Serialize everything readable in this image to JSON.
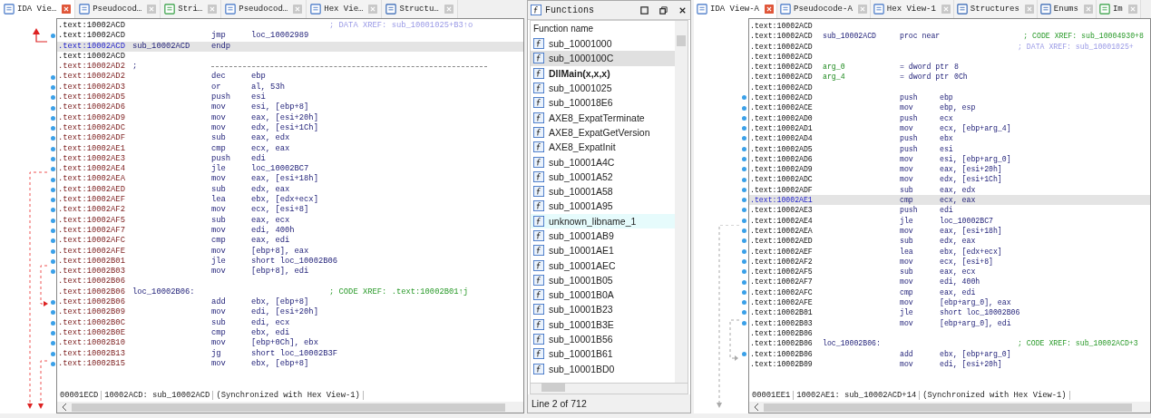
{
  "left_view": {
    "tabs": [
      {
        "label": "IDA Vie…",
        "kind": "listing",
        "selected": true
      },
      {
        "label": "Pseudocod…",
        "kind": "pseudocode",
        "selected": false
      },
      {
        "label": "Stri…",
        "kind": "strings",
        "selected": false
      },
      {
        "label": "Pseudocod…",
        "kind": "pseudocode",
        "selected": false
      },
      {
        "label": "Hex Vie…",
        "kind": "hex",
        "selected": false
      },
      {
        "label": "Structu…",
        "kind": "struct",
        "selected": false
      }
    ],
    "lines": [
      {
        "address": {
          "text": ".text:10002ACD",
          "kind": "plain"
        },
        "comment": {
          "text": "; DATA XREF: sub_10001025+B3↑o",
          "kind": "data"
        },
        "highlighted": false,
        "dot": false
      },
      {
        "address": {
          "text": ".text:10002ACD",
          "kind": "plain"
        },
        "mnemonic": "jmp",
        "operands": "loc_10002989",
        "highlighted": false,
        "dot": true
      },
      {
        "address": {
          "text": ".text:10002ACD"
        },
        "label": {
          "text": "sub_10002ACD",
          "kind": "name"
        },
        "mnemonic": "endp",
        "highlighted": true,
        "dot": false
      },
      {
        "address": {
          "text": ".text:10002ACD",
          "kind": "plain"
        },
        "highlighted": false,
        "dot": false
      },
      {
        "address": {
          "text": ".text:10002AD2",
          "kind": "code"
        },
        "label": {
          "text": ";",
          "kind": "name"
        },
        "separator": true,
        "highlighted": false,
        "dot": false
      },
      {
        "address": {
          "text": ".text:10002AD2",
          "kind": "code"
        },
        "mnemonic": "dec",
        "operands": "ebp",
        "highlighted": false,
        "dot": true
      },
      {
        "address": {
          "text": ".text:10002AD3",
          "kind": "code"
        },
        "mnemonic": "or",
        "operands": "al, 53h",
        "highlighted": false,
        "dot": true
      },
      {
        "address": {
          "text": ".text:10002AD5",
          "kind": "code"
        },
        "mnemonic": "push",
        "operands": "esi",
        "highlighted": false,
        "dot": true
      },
      {
        "address": {
          "text": ".text:10002AD6",
          "kind": "code"
        },
        "mnemonic": "mov",
        "operands": "esi, [ebp+8]",
        "highlighted": false,
        "dot": true
      },
      {
        "address": {
          "text": ".text:10002AD9",
          "kind": "code"
        },
        "mnemonic": "mov",
        "operands": "eax, [esi+20h]",
        "highlighted": false,
        "dot": true
      },
      {
        "address": {
          "text": ".text:10002ADC",
          "kind": "code"
        },
        "mnemonic": "mov",
        "operands": "edx, [esi+1Ch]",
        "highlighted": false,
        "dot": true
      },
      {
        "address": {
          "text": ".text:10002ADF",
          "kind": "code"
        },
        "mnemonic": "sub",
        "operands": "eax, edx",
        "highlighted": false,
        "dot": true
      },
      {
        "address": {
          "text": ".text:10002AE1",
          "kind": "code"
        },
        "mnemonic": "cmp",
        "operands": "ecx, eax",
        "highlighted": false,
        "dot": true
      },
      {
        "address": {
          "text": ".text:10002AE3",
          "kind": "code"
        },
        "mnemonic": "push",
        "operands": "edi",
        "highlighted": false,
        "dot": true
      },
      {
        "address": {
          "text": ".text:10002AE4",
          "kind": "code"
        },
        "mnemonic": "jle",
        "operands": "loc_10002BC7",
        "highlighted": false,
        "dot": true
      },
      {
        "address": {
          "text": ".text:10002AEA",
          "kind": "code"
        },
        "mnemonic": "mov",
        "operands": "eax, [esi+18h]",
        "highlighted": false,
        "dot": true
      },
      {
        "address": {
          "text": ".text:10002AED",
          "kind": "code"
        },
        "mnemonic": "sub",
        "operands": "edx, eax",
        "highlighted": false,
        "dot": true
      },
      {
        "address": {
          "text": ".text:10002AEF",
          "kind": "code"
        },
        "mnemonic": "lea",
        "operands": "ebx, [edx+ecx]",
        "highlighted": false,
        "dot": true
      },
      {
        "address": {
          "text": ".text:10002AF2",
          "kind": "code"
        },
        "mnemonic": "mov",
        "operands": "ecx, [esi+8]",
        "highlighted": false,
        "dot": true
      },
      {
        "address": {
          "text": ".text:10002AF5",
          "kind": "code"
        },
        "mnemonic": "sub",
        "operands": "eax, ecx",
        "highlighted": false,
        "dot": true
      },
      {
        "address": {
          "text": ".text:10002AF7",
          "kind": "code"
        },
        "mnemonic": "mov",
        "operands": "edi, 400h",
        "highlighted": false,
        "dot": true
      },
      {
        "address": {
          "text": ".text:10002AFC",
          "kind": "code"
        },
        "mnemonic": "cmp",
        "operands": "eax, edi",
        "highlighted": false,
        "dot": true
      },
      {
        "address": {
          "text": ".text:10002AFE",
          "kind": "code"
        },
        "mnemonic": "mov",
        "operands": "[ebp+8], eax",
        "highlighted": false,
        "dot": true
      },
      {
        "address": {
          "text": ".text:10002B01",
          "kind": "code"
        },
        "mnemonic": "jle",
        "operands": "short loc_10002B06",
        "highlighted": false,
        "dot": true
      },
      {
        "address": {
          "text": ".text:10002B03",
          "kind": "code"
        },
        "mnemonic": "mov",
        "operands": "[ebp+8], edi",
        "highlighted": false,
        "dot": true
      },
      {
        "address": {
          "text": ".text:10002B06",
          "kind": "code"
        },
        "highlighted": false,
        "dot": false
      },
      {
        "address": {
          "text": ".text:10002B06",
          "kind": "code"
        },
        "label": {
          "text": "loc_10002B06:",
          "kind": "name"
        },
        "comment": {
          "text": "; CODE XREF: .text:10002B01↑j",
          "kind": "code"
        },
        "highlighted": false,
        "dot": false
      },
      {
        "address": {
          "text": ".text:10002B06",
          "kind": "code"
        },
        "mnemonic": "add",
        "operands": "ebx, [ebp+8]",
        "highlighted": false,
        "dot": true
      },
      {
        "address": {
          "text": ".text:10002B09",
          "kind": "code"
        },
        "mnemonic": "mov",
        "operands": "edi, [esi+20h]",
        "highlighted": false,
        "dot": true
      },
      {
        "address": {
          "text": ".text:10002B0C",
          "kind": "code"
        },
        "mnemonic": "sub",
        "operands": "edi, ecx",
        "highlighted": false,
        "dot": true
      },
      {
        "address": {
          "text": ".text:10002B0E",
          "kind": "code"
        },
        "mnemonic": "cmp",
        "operands": "ebx, edi",
        "highlighted": false,
        "dot": true
      },
      {
        "address": {
          "text": ".text:10002B10",
          "kind": "code"
        },
        "mnemonic": "mov",
        "operands": "[ebp+0Ch], ebx",
        "highlighted": false,
        "dot": true
      },
      {
        "address": {
          "text": ".text:10002B13",
          "kind": "code"
        },
        "mnemonic": "jg",
        "operands": "short loc_10002B3F",
        "highlighted": false,
        "dot": true
      },
      {
        "address": {
          "text": ".text:10002B15",
          "kind": "code"
        },
        "mnemonic": "mov",
        "operands": "ebx, [ebp+8]",
        "highlighted": false,
        "dot": true
      }
    ],
    "status_bar": [
      "00001ECD",
      "10002ACD: sub_10002ACD",
      "(Synchronized with Hex View-1)"
    ]
  },
  "functions": {
    "title": "Functions",
    "column": "Function name",
    "items": [
      {
        "name": "sub_10001000",
        "kind": "regular",
        "selected": false
      },
      {
        "name": "sub_1000100C",
        "kind": "regular",
        "selected": true
      },
      {
        "name": "DllMain(x,x,x)",
        "kind": "entry",
        "selected": false
      },
      {
        "name": "sub_10001025",
        "kind": "regular",
        "selected": false
      },
      {
        "name": "sub_100018E6",
        "kind": "regular",
        "selected": false
      },
      {
        "name": "AXE8_ExpatTerminate",
        "kind": "regular",
        "selected": false
      },
      {
        "name": "AXE8_ExpatGetVersion",
        "kind": "regular",
        "selected": false
      },
      {
        "name": "AXE8_ExpatInit",
        "kind": "regular",
        "selected": false
      },
      {
        "name": "sub_10001A4C",
        "kind": "regular",
        "selected": false
      },
      {
        "name": "sub_10001A52",
        "kind": "regular",
        "selected": false
      },
      {
        "name": "sub_10001A58",
        "kind": "regular",
        "selected": false
      },
      {
        "name": "sub_10001A95",
        "kind": "regular",
        "selected": false
      },
      {
        "name": "unknown_libname_1",
        "kind": "library",
        "selected": false
      },
      {
        "name": "sub_10001AB9",
        "kind": "regular",
        "selected": false
      },
      {
        "name": "sub_10001AE1",
        "kind": "regular",
        "selected": false
      },
      {
        "name": "sub_10001AEC",
        "kind": "regular",
        "selected": false
      },
      {
        "name": "sub_10001B05",
        "kind": "regular",
        "selected": false
      },
      {
        "name": "sub_10001B0A",
        "kind": "regular",
        "selected": false
      },
      {
        "name": "sub_10001B23",
        "kind": "regular",
        "selected": false
      },
      {
        "name": "sub_10001B3E",
        "kind": "regular",
        "selected": false
      },
      {
        "name": "sub_10001B56",
        "kind": "regular",
        "selected": false
      },
      {
        "name": "sub_10001B61",
        "kind": "regular",
        "selected": false
      },
      {
        "name": "sub_10001BD0",
        "kind": "regular",
        "selected": false
      }
    ],
    "status": "Line 2 of 712"
  },
  "right_view": {
    "tabs": [
      {
        "label": "IDA View-A",
        "kind": "listing",
        "selected": true
      },
      {
        "label": "Pseudocode-A",
        "kind": "pseudocode",
        "selected": false
      },
      {
        "label": "Hex View-1",
        "kind": "hex",
        "selected": false
      },
      {
        "label": "Structures",
        "kind": "struct",
        "selected": false
      },
      {
        "label": "Enums",
        "kind": "enum",
        "selected": false
      },
      {
        "label": "Im",
        "kind": "imports",
        "selected": false
      }
    ],
    "lines": [
      {
        "address": {
          "text": ".text:10002ACD",
          "kind": "plain"
        },
        "highlighted": false,
        "dot": false
      },
      {
        "address": {
          "text": ".text:10002ACD",
          "kind": "plain"
        },
        "label": {
          "text": "sub_10002ACD",
          "kind": "name"
        },
        "mnemonic": "proc near",
        "comment": {
          "text": "; CODE XREF: sub_10004930+8",
          "kind": "code"
        },
        "highlighted": false,
        "dot": false
      },
      {
        "address": {
          "text": ".text:10002ACD",
          "kind": "plain"
        },
        "comment": {
          "text": "; DATA XREF: sub_10001025+",
          "kind": "data"
        },
        "highlighted": false,
        "dot": false
      },
      {
        "address": {
          "text": ".text:10002ACD",
          "kind": "plain"
        },
        "highlighted": false,
        "dot": false
      },
      {
        "address": {
          "text": ".text:10002ACD",
          "kind": "plain"
        },
        "label": {
          "text": "arg_0",
          "kind": "argument"
        },
        "mnemonic": "= dword ptr",
        "operands": "8",
        "highlighted": false,
        "dot": false
      },
      {
        "address": {
          "text": ".text:10002ACD",
          "kind": "plain"
        },
        "label": {
          "text": "arg_4",
          "kind": "argument"
        },
        "mnemonic": "= dword ptr",
        "operands": "0Ch",
        "highlighted": false,
        "dot": false
      },
      {
        "address": {
          "text": ".text:10002ACD",
          "kind": "plain"
        },
        "highlighted": false,
        "dot": false
      },
      {
        "address": {
          "text": ".text:10002ACD",
          "kind": "plain"
        },
        "mnemonic": "push",
        "operands": "ebp",
        "highlighted": false,
        "dot": true
      },
      {
        "address": {
          "text": ".text:10002ACE",
          "kind": "plain"
        },
        "mnemonic": "mov",
        "operands": "ebp, esp",
        "highlighted": false,
        "dot": true
      },
      {
        "address": {
          "text": ".text:10002AD0",
          "kind": "plain"
        },
        "mnemonic": "push",
        "operands": "ecx",
        "highlighted": false,
        "dot": true
      },
      {
        "address": {
          "text": ".text:10002AD1",
          "kind": "plain"
        },
        "mnemonic": "mov",
        "operands": "ecx, [ebp+arg_4]",
        "highlighted": false,
        "dot": true
      },
      {
        "address": {
          "text": ".text:10002AD4",
          "kind": "plain"
        },
        "mnemonic": "push",
        "operands": "ebx",
        "highlighted": false,
        "dot": true
      },
      {
        "address": {
          "text": ".text:10002AD5",
          "kind": "plain"
        },
        "mnemonic": "push",
        "operands": "esi",
        "highlighted": false,
        "dot": true
      },
      {
        "address": {
          "text": ".text:10002AD6",
          "kind": "plain"
        },
        "mnemonic": "mov",
        "operands": "esi, [ebp+arg_0]",
        "highlighted": false,
        "dot": true
      },
      {
        "address": {
          "text": ".text:10002AD9",
          "kind": "plain"
        },
        "mnemonic": "mov",
        "operands": "eax, [esi+20h]",
        "highlighted": false,
        "dot": true
      },
      {
        "address": {
          "text": ".text:10002ADC",
          "kind": "plain"
        },
        "mnemonic": "mov",
        "operands": "edx, [esi+1Ch]",
        "highlighted": false,
        "dot": true
      },
      {
        "address": {
          "text": ".text:10002ADF",
          "kind": "plain"
        },
        "mnemonic": "sub",
        "operands": "eax, edx",
        "highlighted": false,
        "dot": true
      },
      {
        "address": {
          "text": ".text:10002AE1"
        },
        "mnemonic": "cmp",
        "operands": "ecx, eax",
        "highlighted": true,
        "dot": true
      },
      {
        "address": {
          "text": ".text:10002AE3",
          "kind": "plain"
        },
        "mnemonic": "push",
        "operands": "edi",
        "highlighted": false,
        "dot": true
      },
      {
        "address": {
          "text": ".text:10002AE4",
          "kind": "plain"
        },
        "mnemonic": "jle",
        "operands": "loc_10002BC7",
        "highlighted": false,
        "dot": true
      },
      {
        "address": {
          "text": ".text:10002AEA",
          "kind": "plain"
        },
        "mnemonic": "mov",
        "operands": "eax, [esi+18h]",
        "highlighted": false,
        "dot": true
      },
      {
        "address": {
          "text": ".text:10002AED",
          "kind": "plain"
        },
        "mnemonic": "sub",
        "operands": "edx, eax",
        "highlighted": false,
        "dot": true
      },
      {
        "address": {
          "text": ".text:10002AEF",
          "kind": "plain"
        },
        "mnemonic": "lea",
        "operands": "ebx, [edx+ecx]",
        "highlighted": false,
        "dot": true
      },
      {
        "address": {
          "text": ".text:10002AF2",
          "kind": "plain"
        },
        "mnemonic": "mov",
        "operands": "ecx, [esi+8]",
        "highlighted": false,
        "dot": true
      },
      {
        "address": {
          "text": ".text:10002AF5",
          "kind": "plain"
        },
        "mnemonic": "sub",
        "operands": "eax, ecx",
        "highlighted": false,
        "dot": true
      },
      {
        "address": {
          "text": ".text:10002AF7",
          "kind": "plain"
        },
        "mnemonic": "mov",
        "operands": "edi, 400h",
        "highlighted": false,
        "dot": true
      },
      {
        "address": {
          "text": ".text:10002AFC",
          "kind": "plain"
        },
        "mnemonic": "cmp",
        "operands": "eax, edi",
        "highlighted": false,
        "dot": true
      },
      {
        "address": {
          "text": ".text:10002AFE",
          "kind": "plain"
        },
        "mnemonic": "mov",
        "operands": "[ebp+arg_0], eax",
        "highlighted": false,
        "dot": true
      },
      {
        "address": {
          "text": ".text:10002B01",
          "kind": "plain"
        },
        "mnemonic": "jle",
        "operands": "short loc_10002B06",
        "highlighted": false,
        "dot": true
      },
      {
        "address": {
          "text": ".text:10002B03",
          "kind": "plain"
        },
        "mnemonic": "mov",
        "operands": "[ebp+arg_0], edi",
        "highlighted": false,
        "dot": true
      },
      {
        "address": {
          "text": ".text:10002B06",
          "kind": "plain"
        },
        "highlighted": false,
        "dot": false
      },
      {
        "address": {
          "text": ".text:10002B06",
          "kind": "plain"
        },
        "label": {
          "text": "loc_10002B06:",
          "kind": "name"
        },
        "comment": {
          "text": "; CODE XREF: sub_10002ACD+3",
          "kind": "code"
        },
        "highlighted": false,
        "dot": false
      },
      {
        "address": {
          "text": ".text:10002B06",
          "kind": "plain"
        },
        "mnemonic": "add",
        "operands": "ebx, [ebp+arg_0]",
        "highlighted": false,
        "dot": true
      },
      {
        "address": {
          "text": ".text:10002B09",
          "kind": "plain"
        },
        "mnemonic": "mov",
        "operands": "edi, [esi+20h]",
        "highlighted": false,
        "dot": false
      }
    ],
    "status_bar": [
      "00001EE1",
      "10002AE1: sub_10002ACD+14",
      "(Synchronized with Hex View-1)"
    ]
  }
}
